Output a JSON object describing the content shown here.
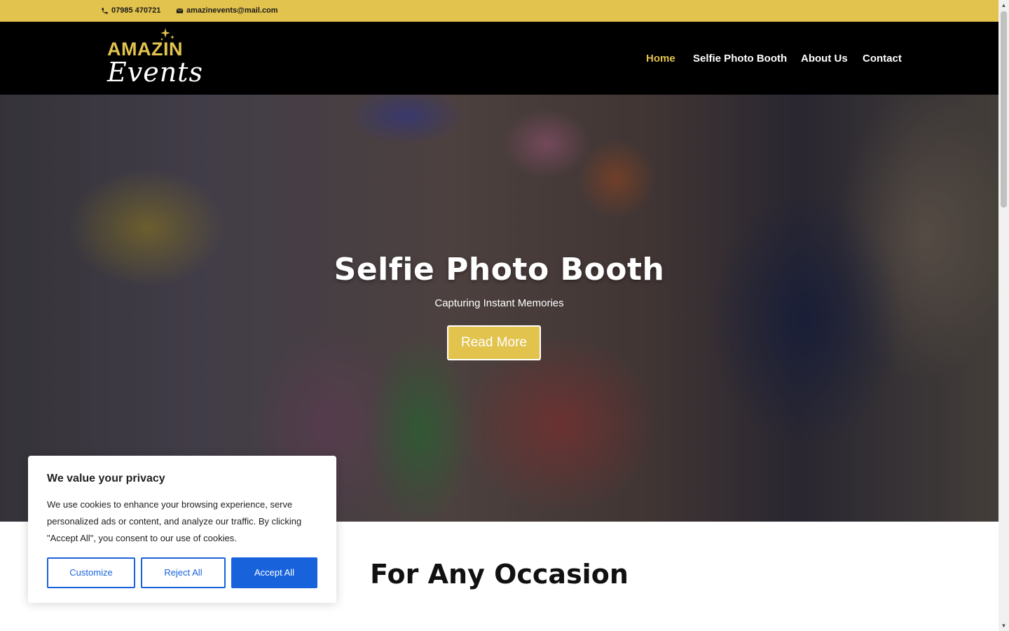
{
  "topbar": {
    "phone": "07985 470721",
    "email": "amazinevents@mail.com"
  },
  "logo": {
    "line1": "AMAZIN",
    "line2": "Events"
  },
  "nav": {
    "items": [
      {
        "label": "Home",
        "active": true
      },
      {
        "label": "Selfie Photo Booth",
        "active": false
      },
      {
        "label": "About Us",
        "active": false
      },
      {
        "label": "Contact",
        "active": false
      }
    ]
  },
  "hero": {
    "title": "Selfie Photo Booth",
    "subtitle": "Capturing Instant Memories",
    "button_label": "Read More"
  },
  "section": {
    "heading": "For Any Occasion"
  },
  "cookie_banner": {
    "title": "We value your privacy",
    "text": "We use cookies to enhance your browsing experience, serve personalized ads or content, and analyze our traffic. By clicking \"Accept All\", you consent to our use of cookies.",
    "customize_label": "Customize",
    "reject_label": "Reject All",
    "accept_label": "Accept All"
  },
  "colors": {
    "accent": "#e2c34e",
    "header_bg": "#000000",
    "cookie_primary": "#1863dc"
  }
}
